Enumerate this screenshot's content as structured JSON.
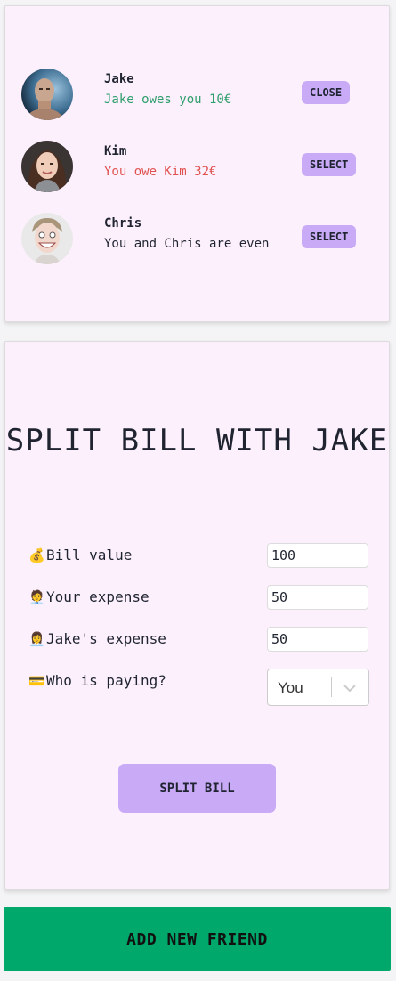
{
  "friends": [
    {
      "name": "Jake",
      "balance": "Jake owes you 10€",
      "balance_color": "#2e9e6b",
      "button_label": "CLOSE",
      "avatar": "man-portrait-photo"
    },
    {
      "name": "Kim",
      "balance": "You owe Kim 32€",
      "balance_color": "#e0524f",
      "button_label": "SELECT",
      "avatar": "woman-portrait-photo"
    },
    {
      "name": "Chris",
      "balance": "You and Chris are even",
      "balance_color": "#1f2430",
      "button_label": "SELECT",
      "avatar": "man-grinning-portrait-photo"
    }
  ],
  "form": {
    "title": "SPLIT BILL WITH JAKE",
    "bill_emoji": "💰",
    "bill_label": "Bill value",
    "bill_value": "100",
    "your_expense_emoji": "🧑‍💼",
    "your_expense_label": "Your expense",
    "your_expense_value": "50",
    "friend_expense_emoji": "👩‍💼",
    "friend_expense_label": "Jake's expense",
    "friend_expense_value": "50",
    "payer_emoji": "💳",
    "payer_label": "Who is paying?",
    "payer_value": "You",
    "submit_label": "SPLIT BILL"
  },
  "add_friend_label": "ADD NEW FRIEND",
  "colors": {
    "accent": "#c8aaf7",
    "panel_bg": "#fdf0fd",
    "add_button": "#00a86b"
  }
}
